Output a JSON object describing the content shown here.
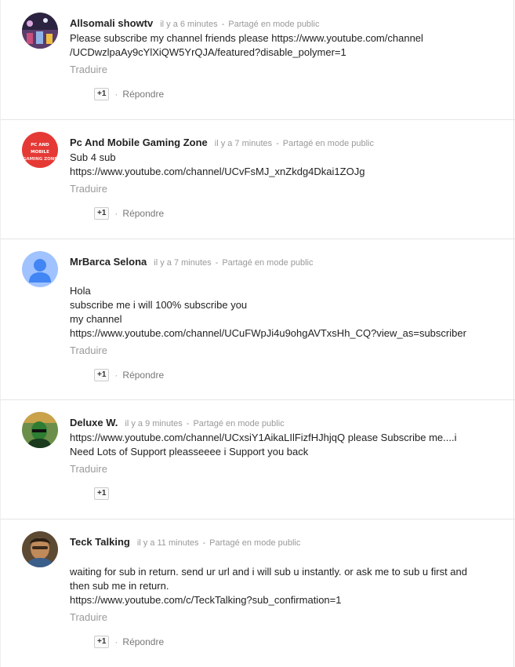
{
  "comments": [
    {
      "author": "Allsomali showtv",
      "time": "il y a 6 minutes",
      "visibility": "Partagé en mode public",
      "lines": [
        "Please subscribe my channel friends please https://www.youtube.com/channel",
        "/UCDwzlpaAy9cYlXiQW5YrQJA/featured?disable_polymer=1"
      ],
      "translate": "Traduire",
      "plus": "+1",
      "reply": "Répondre",
      "avatar_color": "#3a2f4f"
    },
    {
      "author": "Pc And Mobile Gaming Zone",
      "time": "il y a 7 minutes",
      "visibility": "Partagé en mode public",
      "lines": [
        "Sub 4 sub",
        "https://www.youtube.com/channel/UCvFsMJ_xnZkdg4Dkai1ZOJg"
      ],
      "translate": "Traduire",
      "plus": "+1",
      "reply": "Répondre",
      "avatar_logo_top": "PC AND MOBILE",
      "avatar_logo_bottom": "GAMING ZONE",
      "avatar_color": "#e53935"
    },
    {
      "author": "MrBarca Selona",
      "time": "il y a 7 minutes",
      "visibility": "Partagé en mode public",
      "lines": [
        "Hola",
        "subscribe me i will 100% subscribe you",
        "my channel",
        "https://www.youtube.com/channel/UCuFWpJi4u9ohgAVTxsHh_CQ?view_as=subscriber"
      ],
      "translate": "Traduire",
      "plus": "+1",
      "reply": "Répondre",
      "avatar_color": "#a0c3ff"
    },
    {
      "author": "Deluxe W.",
      "time": "il y a 9 minutes",
      "visibility": "Partagé en mode public",
      "lines": [
        "https://www.youtube.com/channel/UCxsiY1AikaLIlFizfHJhjqQ please Subscribe me....i",
        "Need Lots of Support pleasseeee i Support you back"
      ],
      "translate": "Traduire",
      "plus": "+1",
      "avatar_color": "#4a7a3a"
    },
    {
      "author": "Teck Talking",
      "time": "il y a 11 minutes",
      "visibility": "Partagé en mode public",
      "lines": [
        "waiting for sub in return. send ur url and i will sub u instantly. or ask me to sub u first and",
        "then sub me in return.",
        "https://www.youtube.com/c/TeckTalking?sub_confirmation=1"
      ],
      "translate": "Traduire",
      "plus": "+1",
      "reply": "Répondre",
      "avatar_color": "#7a5a3a"
    }
  ]
}
